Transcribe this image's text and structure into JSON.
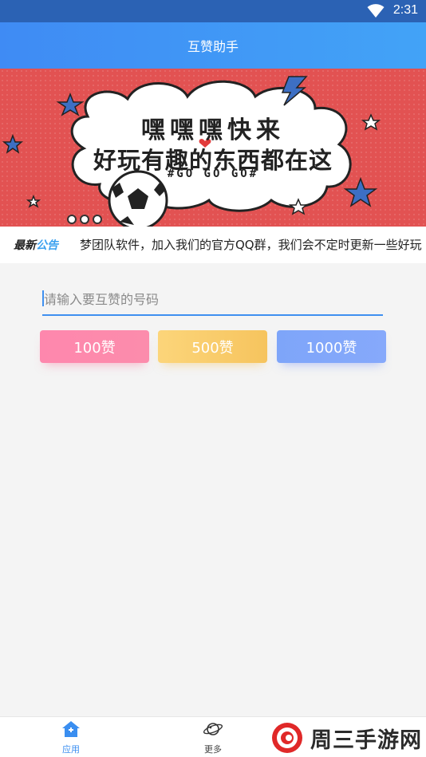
{
  "status_bar": {
    "time": "2:31"
  },
  "header": {
    "title": "互赞助手"
  },
  "banner": {
    "headline": "嘿嘿嘿快来",
    "subline": "好玩有趣的东西都在这",
    "hashtag": "#GO GO GO#"
  },
  "notice": {
    "badge_part1": "最新",
    "badge_part2": "公告",
    "text": "梦团队软件，加入我们的官方QQ群，我们会不定时更新一些好玩"
  },
  "form": {
    "input_placeholder": "请输入要互赞的号码",
    "input_value": ""
  },
  "buttons": {
    "b100": "100赞",
    "b500": "500赞",
    "b1000": "1000赞"
  },
  "bottom_nav": {
    "apps_label": "应用",
    "more_label": "更多"
  },
  "watermark": {
    "text": "周三手游网"
  },
  "colors": {
    "header_start": "#3f8bf4",
    "header_end": "#42a3f7",
    "accent": "#3f90f0",
    "banner_bg": "#e25252",
    "btn_pink": "#fe87ad",
    "btn_yellow": "#f6c45e",
    "btn_blue": "#7ea5f9"
  }
}
